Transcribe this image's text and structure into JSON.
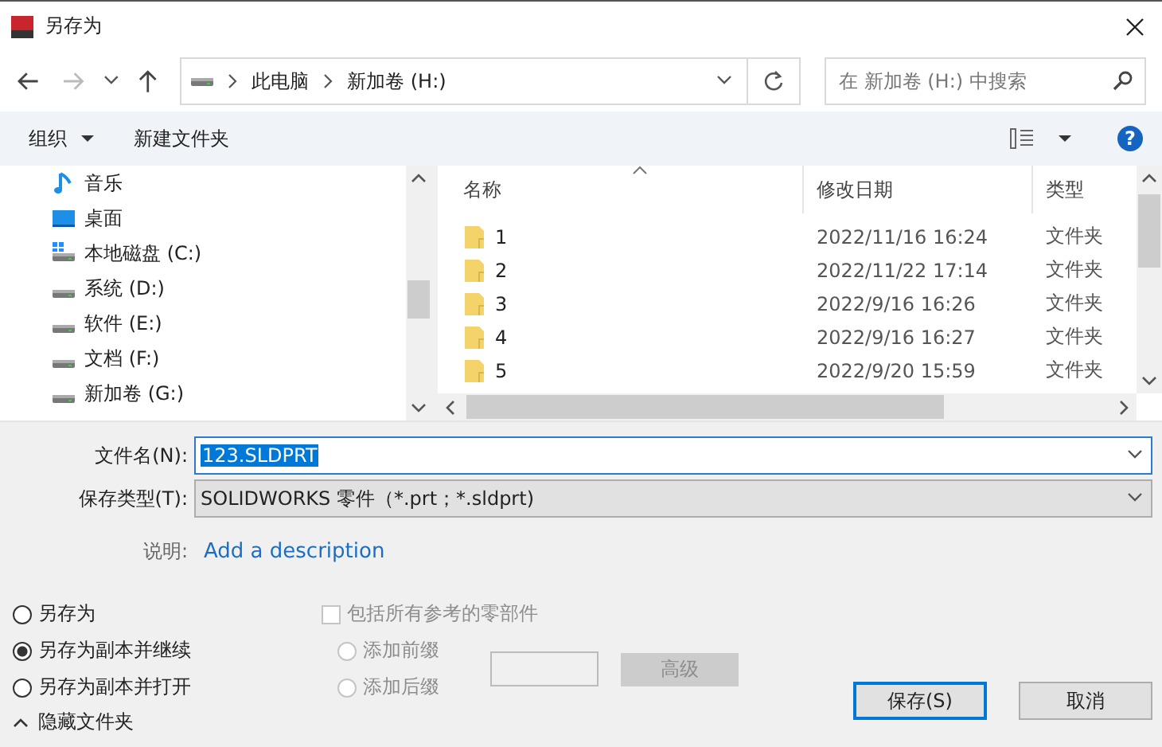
{
  "window": {
    "title": "另存为"
  },
  "navigation": {
    "path": [
      "此电脑",
      "新加卷 (H:)"
    ],
    "search": {
      "placeholder": "在 新加卷 (H:) 中搜索"
    }
  },
  "toolbar": {
    "organize": "组织",
    "new_folder": "新建文件夹",
    "help": "?"
  },
  "sidebar": {
    "items": [
      {
        "label": "音乐",
        "kind": "music"
      },
      {
        "label": "桌面",
        "kind": "desktop"
      },
      {
        "label": "本地磁盘 (C:)",
        "kind": "system-drive"
      },
      {
        "label": "系统 (D:)",
        "kind": "drive"
      },
      {
        "label": "软件 (E:)",
        "kind": "drive"
      },
      {
        "label": "文档 (F:)",
        "kind": "drive"
      },
      {
        "label": "新加卷 (G:)",
        "kind": "drive"
      }
    ]
  },
  "file_list": {
    "columns": [
      "名称",
      "修改日期",
      "类型"
    ],
    "rows": [
      {
        "name": "1",
        "modified": "2022/11/16 16:24",
        "type": "文件夹"
      },
      {
        "name": "2",
        "modified": "2022/11/22 17:14",
        "type": "文件夹"
      },
      {
        "name": "3",
        "modified": "2022/9/16 16:26",
        "type": "文件夹"
      },
      {
        "name": "4",
        "modified": "2022/9/16 16:27",
        "type": "文件夹"
      },
      {
        "name": "5",
        "modified": "2022/9/20 15:59",
        "type": "文件夹"
      }
    ]
  },
  "save_form": {
    "filename_label": "文件名(N):",
    "filename": "123.SLDPRT",
    "type_label": "保存类型(T):",
    "type": "SOLIDWORKS 零件（*.prt；*.sldprt)",
    "description_label": "说明:",
    "description_link": "Add a description"
  },
  "save_options": [
    {
      "label": "另存为",
      "selected": false
    },
    {
      "label": "另存为副本并继续",
      "selected": true
    },
    {
      "label": "另存为副本并打开",
      "selected": false
    }
  ],
  "references": {
    "label": "包括所有参考的零部件",
    "checked": false,
    "disabled": true,
    "options": [
      {
        "label": "添加前缀",
        "selected": false
      },
      {
        "label": "添加后缀",
        "selected": false
      }
    ],
    "advanced": "高级"
  },
  "hide_folders": "隐藏文件夹",
  "buttons": [
    {
      "label": "保存(S)",
      "kind": "primary"
    },
    {
      "label": "取消",
      "kind": "secondary"
    }
  ]
}
